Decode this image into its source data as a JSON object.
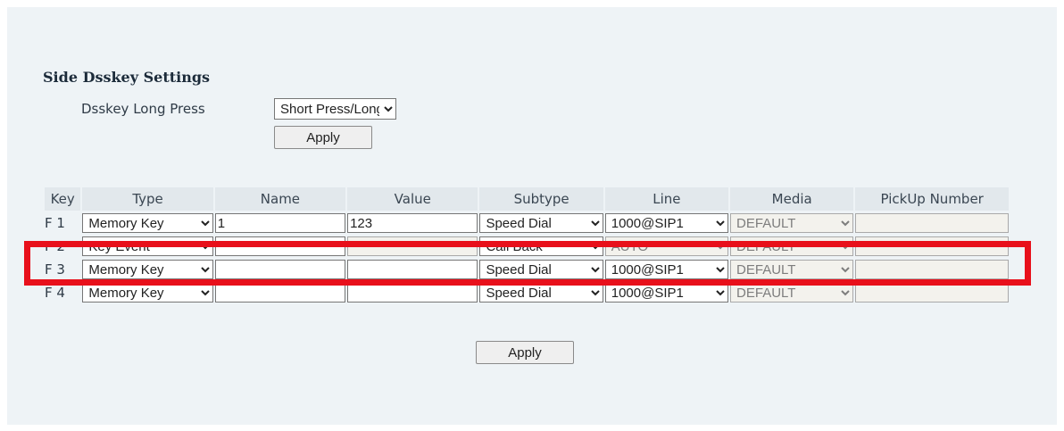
{
  "section": {
    "title": "Side Dsskey Settings",
    "long_press_label": "Dsskey Long Press",
    "long_press_value": "Short Press/Long Press",
    "apply_label": "Apply"
  },
  "table": {
    "headers": [
      "Key",
      "Type",
      "Name",
      "Value",
      "Subtype",
      "Line",
      "Media",
      "PickUp Number"
    ],
    "rows": [
      {
        "key": "F 1",
        "type": "Memory Key",
        "name": "1",
        "value": "123",
        "subtype": "Speed Dial",
        "line": "1000@SIP1",
        "media": "DEFAULT",
        "pickup": ""
      },
      {
        "key": "F 2",
        "type": "Key Event",
        "name": "",
        "value": "",
        "subtype": "Call Back",
        "line": "AUTO",
        "media": "DEFAULT",
        "pickup": ""
      },
      {
        "key": "F 3",
        "type": "Memory Key",
        "name": "",
        "value": "",
        "subtype": "Speed Dial",
        "line": "1000@SIP1",
        "media": "DEFAULT",
        "pickup": ""
      },
      {
        "key": "F 4",
        "type": "Memory Key",
        "name": "",
        "value": "",
        "subtype": "Speed Dial",
        "line": "1000@SIP1",
        "media": "DEFAULT",
        "pickup": ""
      }
    ]
  },
  "bottom_apply_label": "Apply",
  "highlight_color": "#e8101b"
}
